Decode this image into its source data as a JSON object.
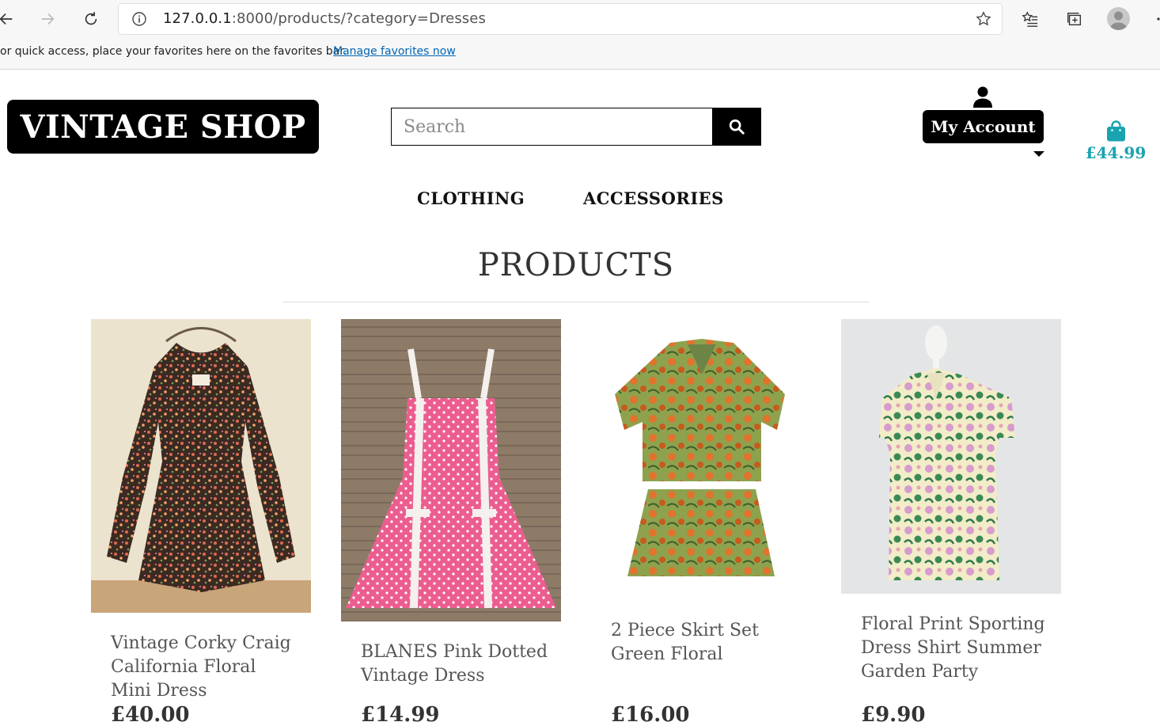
{
  "browser": {
    "url_host": "127.0.0.1",
    "url_path": ":8000/products/?category=Dresses",
    "favorites_message": "or quick access, place your favorites here on the favorites bar.",
    "favorites_link": "Manage favorites now"
  },
  "header": {
    "logo": "VINTAGE SHOP",
    "search_placeholder": "Search",
    "account_label": "My Account",
    "bag_total": "£44.99",
    "accent_color": "#1aa3b0"
  },
  "nav": {
    "items": [
      "CLOTHING",
      "ACCESSORIES"
    ]
  },
  "page": {
    "title": "PRODUCTS"
  },
  "products": [
    {
      "name": "Vintage Corky Craig California Floral Mini Dress",
      "price": "£40.00"
    },
    {
      "name": "BLANES Pink Dotted Vintage Dress",
      "price": "£14.99"
    },
    {
      "name": "2 Piece Skirt Set Green Floral",
      "price": "£16.00"
    },
    {
      "name": "Floral Print Sporting Dress Shirt Summer Garden Party",
      "price": "£9.90"
    }
  ]
}
